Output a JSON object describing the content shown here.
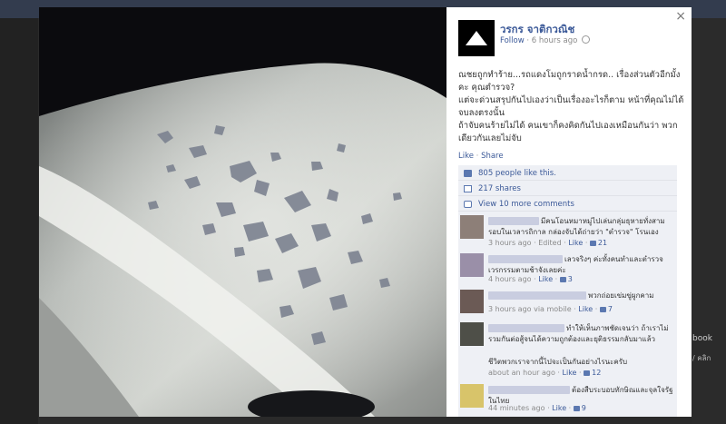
{
  "background": {
    "side_text": "book",
    "side_text2": "/ คลิก"
  },
  "post": {
    "page_name": "วรกร จาติกวณิช",
    "follow": "Follow",
    "time": "6 hours ago",
    "lines": [
      "ณชยถูกทำร้าย...รถแดงโมถูกราดน้ำกรด.. เรื่องส่วนตัวอีกมั้งคะ คุณตำรวจ?",
      "แต่จะด่วนสรุปกันไปเองว่าเป็นเรื่องอะไรก็ตาม หน้าที่คุณไม่ได้จบลงตรงนั้น",
      "ถ้าจับคนร้ายไม่ได้ คนเขาก็คงคิดกันไปเองเหมือนกันว่า พวกเดียวกันเลยไม่จับ"
    ],
    "like": "Like",
    "share": "Share",
    "dot": "·",
    "likes_text": "805 people like this.",
    "shares_text": "217 shares",
    "more_comments": "View 10 more comments",
    "close": "×"
  },
  "comments": [
    {
      "text": "มีคนโอนหมาหมู่ไปเล่นกลุ่มธุหายทั่งสามรอบในเวลารถิกาล กล่องจับได้ถ่ายว่า \"ตำรวจ\" โรนเอง",
      "time": "3 hours ago",
      "edited": "Edited",
      "like": "Like",
      "count": "21"
    },
    {
      "text": "เลวจริงๆ ค่ะทั้งคนทำและตำรวจ เวรกรรมตามช้าจังเลยค่ะ",
      "time": "4 hours ago",
      "like": "Like",
      "count": "3"
    },
    {
      "text": "พวกถ่อยเข่มขู่ผูกคาม",
      "time": "3 hours ago via mobile",
      "like": "Like",
      "count": "7"
    },
    {
      "text": "ทำให้เห็นภาพชัดเจนว่า ถ้าเราไม่รวมกันต่อสู้จนได้ความถูกต้องและยุติธรรมกลับมาแล้ว",
      "text2": "ชีวิตพวกเราจากนี้ไปจะเป็นกันอย่างไรนะครับ",
      "time": "about an hour ago",
      "like": "Like",
      "count": "12"
    },
    {
      "text": "ต้องสืบระบอบทักษิณและจุลใจรัฐในไทย",
      "time": "44 minutes ago",
      "like": "Like",
      "count": "9"
    }
  ]
}
